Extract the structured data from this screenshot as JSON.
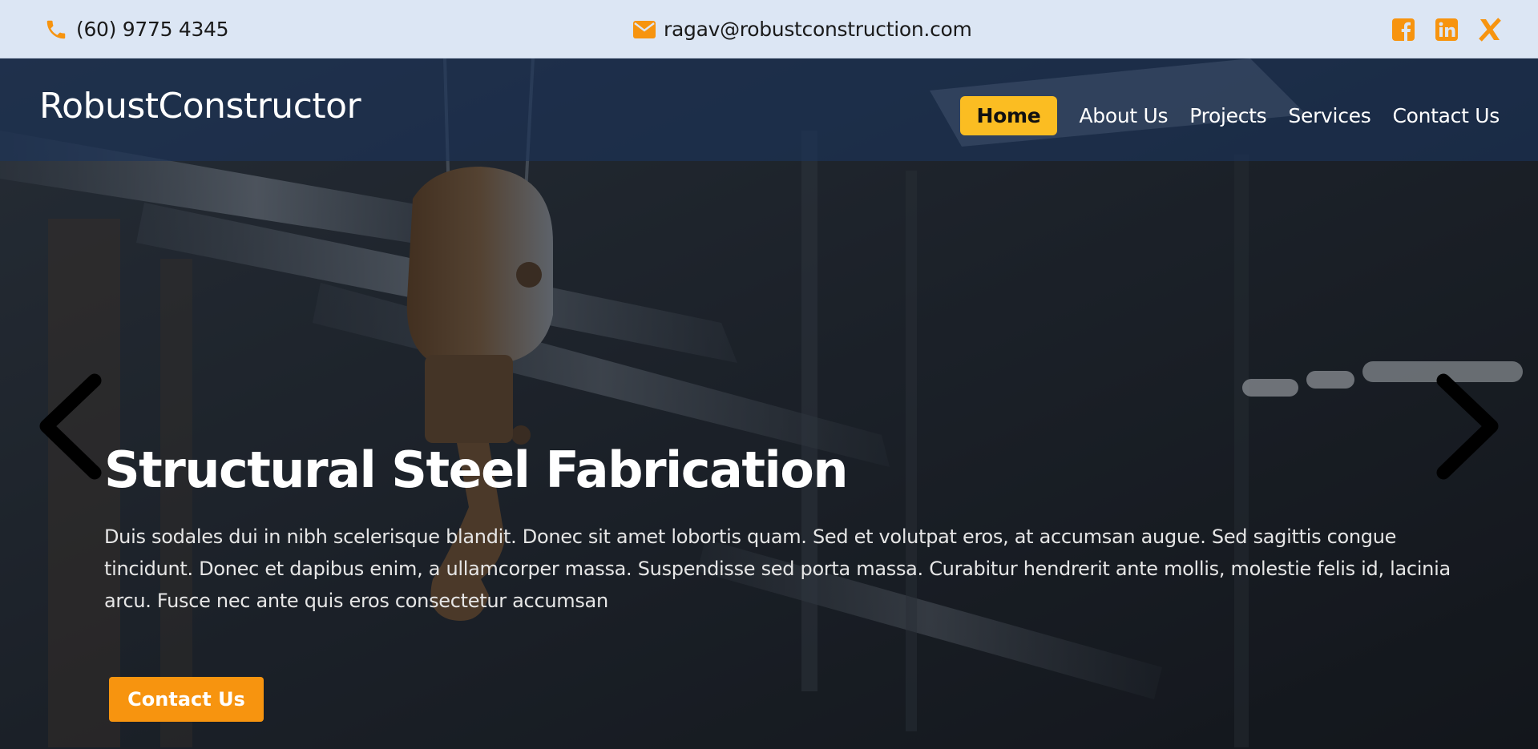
{
  "topbar": {
    "phone": "(60) 9775 4345",
    "email": "ragav@robustconstruction.com",
    "social_icons": [
      "facebook-icon",
      "linkedin-icon",
      "x-icon"
    ]
  },
  "brand": "RobustConstructor",
  "nav": {
    "items": [
      {
        "label": "Home",
        "active": true
      },
      {
        "label": "About Us"
      },
      {
        "label": "Projects"
      },
      {
        "label": "Services"
      },
      {
        "label": "Contact Us"
      }
    ]
  },
  "slide": {
    "title": "Structural Steel Fabrication",
    "text": "Duis sodales dui in nibh scelerisque blandit. Donec sit amet lobortis quam. Sed et volutpat eros, at accumsan augue. Sed sagittis congue tincidunt. Donec et dapibus enim, a ullamcorper massa. Suspendisse sed porta massa. Curabitur hendrerit ante mollis, molestie felis id, lacinia arcu. Fusce nec ante quis eros consectetur accumsan",
    "cta": "Contact Us"
  },
  "colors": {
    "accent": "#f7940f",
    "active_nav": "#fbbd22",
    "topbar_bg": "#dce6f4"
  }
}
